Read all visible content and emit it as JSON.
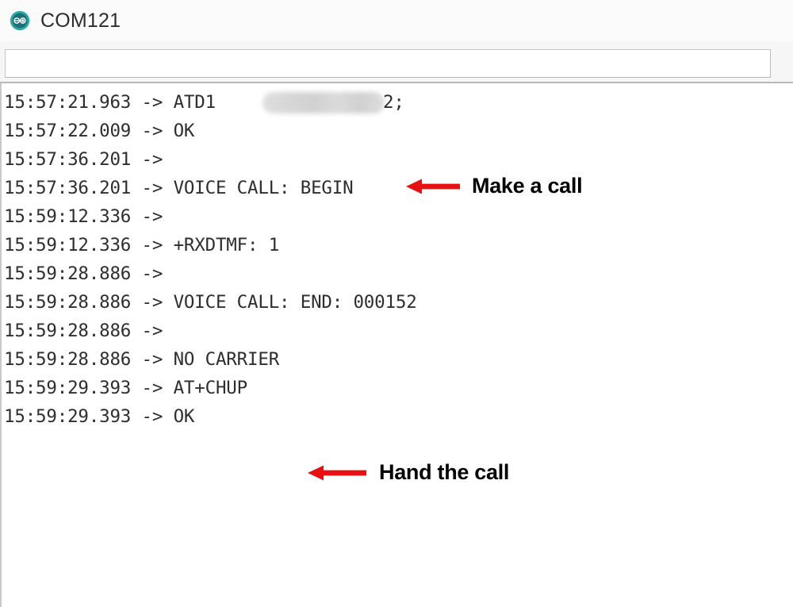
{
  "window": {
    "title": "COM121",
    "icon": "arduino-logo-icon"
  },
  "command_bar": {
    "value": "",
    "placeholder": ""
  },
  "monitor": {
    "lines": [
      {
        "timestamp": "15:57:21.963",
        "arrow": "->",
        "message": "ATD1",
        "redacted": true,
        "suffix": "2;"
      },
      {
        "timestamp": "15:57:22.009",
        "arrow": "->",
        "message": "OK",
        "redacted": false,
        "suffix": ""
      },
      {
        "timestamp": "15:57:36.201",
        "arrow": "->",
        "message": "",
        "redacted": false,
        "suffix": ""
      },
      {
        "timestamp": "15:57:36.201",
        "arrow": "->",
        "message": "VOICE CALL: BEGIN",
        "redacted": false,
        "suffix": ""
      },
      {
        "timestamp": "15:59:12.336",
        "arrow": "->",
        "message": "",
        "redacted": false,
        "suffix": ""
      },
      {
        "timestamp": "15:59:12.336",
        "arrow": "->",
        "message": "+RXDTMF: 1",
        "redacted": false,
        "suffix": ""
      },
      {
        "timestamp": "15:59:28.886",
        "arrow": "->",
        "message": "",
        "redacted": false,
        "suffix": ""
      },
      {
        "timestamp": "15:59:28.886",
        "arrow": "->",
        "message": "VOICE CALL: END: 000152",
        "redacted": false,
        "suffix": ""
      },
      {
        "timestamp": "15:59:28.886",
        "arrow": "->",
        "message": "",
        "redacted": false,
        "suffix": ""
      },
      {
        "timestamp": "15:59:28.886",
        "arrow": "->",
        "message": "NO CARRIER",
        "redacted": false,
        "suffix": ""
      },
      {
        "timestamp": "15:59:29.393",
        "arrow": "->",
        "message": "AT+CHUP",
        "redacted": false,
        "suffix": ""
      },
      {
        "timestamp": "15:59:29.393",
        "arrow": "->",
        "message": "OK",
        "redacted": false,
        "suffix": ""
      }
    ]
  },
  "annotations": [
    {
      "label": "Make a call",
      "icon": "left-arrow-icon",
      "color": "#E81010",
      "target_line": 1
    },
    {
      "label": "Hand the call",
      "icon": "left-arrow-icon",
      "color": "#E81010",
      "target_line": 11
    }
  ],
  "colors": {
    "annotation_red": "#E81010",
    "titlebar_background": "#FBFBFB",
    "log_text": "#2E2E2E",
    "accent_teal": "#1BA0A2"
  }
}
